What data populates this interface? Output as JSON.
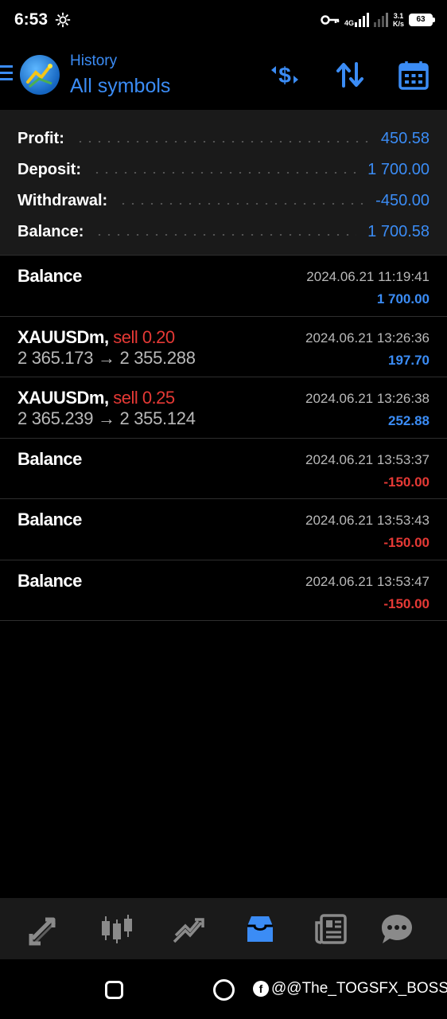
{
  "status_bar": {
    "time": "6:53",
    "network": "4G",
    "net_speed_value": "3.1",
    "net_speed_unit": "K/s",
    "battery": "63"
  },
  "header": {
    "title": "History",
    "subtitle": "All symbols",
    "icons": [
      "menu-icon",
      "deposit-filter-icon",
      "sort-icon",
      "calendar-icon"
    ],
    "accent_color": "#3b8cf5"
  },
  "summary": {
    "rows": [
      {
        "label": "Profit:",
        "value": "450.58"
      },
      {
        "label": "Deposit:",
        "value": "1 700.00"
      },
      {
        "label": "Withdrawal:",
        "value": "-450.00"
      },
      {
        "label": "Balance:",
        "value": "1 700.58"
      }
    ]
  },
  "deals": [
    {
      "symbol": "Balance",
      "type": "",
      "prices": "",
      "time": "2024.06.21 11:19:41",
      "amount": "1 700.00",
      "negative": false
    },
    {
      "symbol": "XAUUSDm,",
      "type": "sell 0.20",
      "prices": "2 365.173 → 2 355.288",
      "time": "2024.06.21 13:26:36",
      "amount": "197.70",
      "negative": false
    },
    {
      "symbol": "XAUUSDm,",
      "type": "sell 0.25",
      "prices": "2 365.239 → 2 355.124",
      "time": "2024.06.21 13:26:38",
      "amount": "252.88",
      "negative": false
    },
    {
      "symbol": "Balance",
      "type": "",
      "prices": "",
      "time": "2024.06.21 13:53:37",
      "amount": "-150.00",
      "negative": true
    },
    {
      "symbol": "Balance",
      "type": "",
      "prices": "",
      "time": "2024.06.21 13:53:43",
      "amount": "-150.00",
      "negative": true
    },
    {
      "symbol": "Balance",
      "type": "",
      "prices": "",
      "time": "2024.06.21 13:53:47",
      "amount": "-150.00",
      "negative": true
    }
  ],
  "bottom_nav": {
    "items": [
      "quotes-icon",
      "chart-icon",
      "trade-icon",
      "history-icon",
      "news-icon",
      "chat-icon"
    ],
    "active": "history-icon"
  },
  "system_nav": {
    "watermark": "@@The_TOGSFX_BOSS"
  },
  "colors": {
    "positive": "#3b8cf5",
    "negative": "#e53935",
    "background": "#000000",
    "panel": "#1a1a1a"
  }
}
